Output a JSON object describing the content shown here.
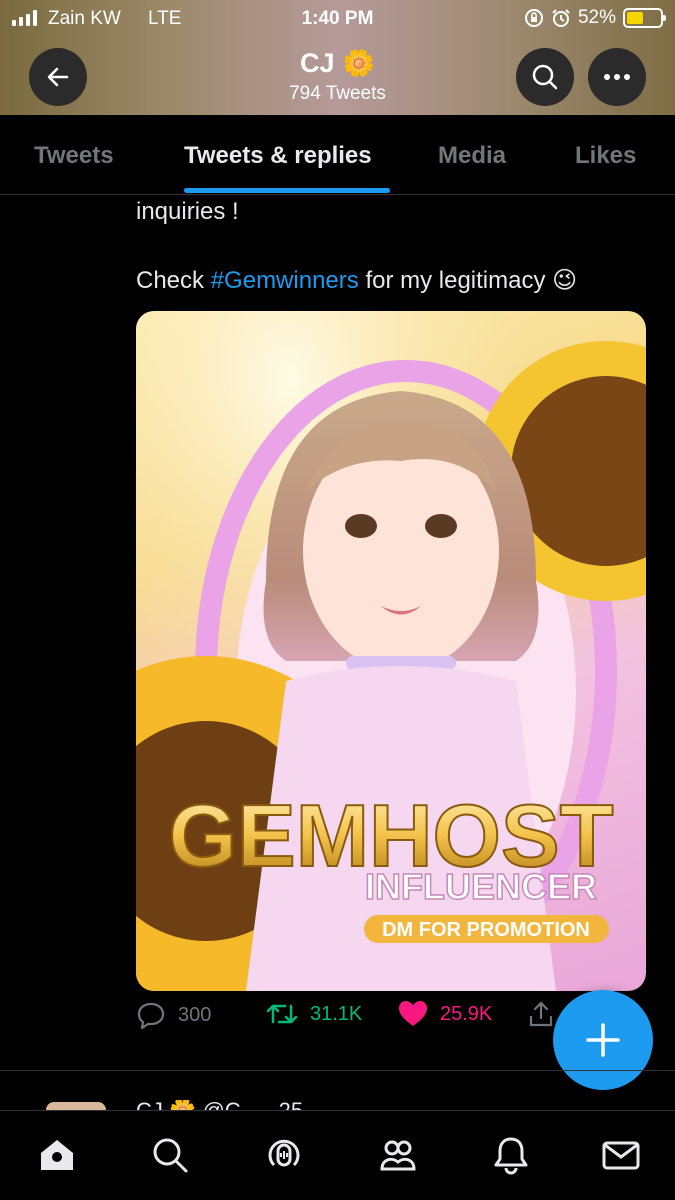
{
  "status_bar": {
    "carrier": "Zain KW",
    "network": "LTE",
    "time": "1:40 PM",
    "battery": "52%",
    "battery_level": 0.52
  },
  "header": {
    "name": "CJ",
    "name_emoji": "🌼",
    "tweet_count": "794 Tweets",
    "icons": [
      "back-arrow-icon",
      "search-icon",
      "more-icon"
    ]
  },
  "tabs": [
    {
      "label": "Tweets",
      "active": false
    },
    {
      "label": "Tweets & replies",
      "active": true
    },
    {
      "label": "Media",
      "active": false
    },
    {
      "label": "Likes",
      "active": false
    }
  ],
  "tweet": {
    "text_line1": "inquiries !",
    "text_check": "Check",
    "hashtag": "#Gemwinners",
    "text_after": "for my legitimacy",
    "emoji": "😉",
    "media": {
      "title": "GEMHOST",
      "subtitle": "INFLUENCER",
      "badge": "DM FOR PROMOTION"
    },
    "counts": {
      "replies": "300",
      "retweets": "31.1K",
      "likes": "25.9K"
    }
  },
  "next_tweet_peek": "CJ 🌼 @C... · 25",
  "colors": {
    "accent": "#1d9bf0",
    "retweet": "#00ba7c",
    "like": "#f91880",
    "muted": "#71767b"
  },
  "bottom_nav": [
    "home-icon",
    "explore-icon",
    "spaces-icon",
    "communities-icon",
    "notifications-icon",
    "messages-icon"
  ]
}
